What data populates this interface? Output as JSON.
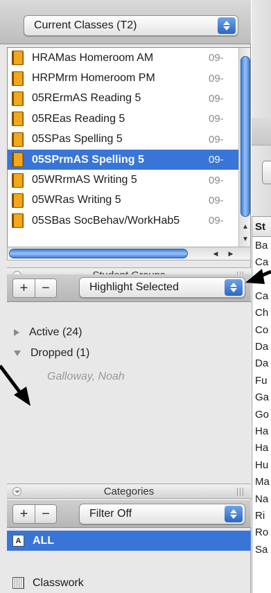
{
  "classes_popup": {
    "label": "Current Classes (T2)"
  },
  "class_list": [
    {
      "name": "HRAMas Homeroom AM",
      "date": "09-",
      "selected": false
    },
    {
      "name": "HRPMrm Homeroom PM",
      "date": "09-",
      "selected": false
    },
    {
      "name": "05RErmAS Reading 5",
      "date": "09-",
      "selected": false
    },
    {
      "name": "05REas Reading 5",
      "date": "09-",
      "selected": false
    },
    {
      "name": "05SPas Spelling 5",
      "date": "09-",
      "selected": false
    },
    {
      "name": "05SPrmAS Spelling 5",
      "date": "09-",
      "selected": true
    },
    {
      "name": "05WRrmAS Writing 5",
      "date": "09-",
      "selected": false
    },
    {
      "name": "05WRas Writing 5",
      "date": "09-",
      "selected": false
    },
    {
      "name": "05SBas SocBehav/WorkHab5",
      "date": "09-",
      "selected": false
    }
  ],
  "student_groups": {
    "title": "Student Groups",
    "add_label": "+",
    "remove_label": "−",
    "popup_label": "Highlight Selected",
    "groups": [
      {
        "label": "Active (24)",
        "expanded": false
      },
      {
        "label": "Dropped (1)",
        "expanded": true
      }
    ],
    "dropped_students": [
      "Galloway, Noah"
    ]
  },
  "categories": {
    "title": "Categories",
    "add_label": "+",
    "remove_label": "−",
    "popup_label": "Filter Off",
    "items": [
      {
        "label": "ALL",
        "icon": "A",
        "selected": true
      },
      {
        "label": "Classwork",
        "icon": "",
        "selected": false
      }
    ]
  },
  "right_table": {
    "header": "St",
    "cells": [
      "Ba",
      "Ca",
      "",
      "Ca",
      "Ch",
      "Co",
      "Da",
      "Da",
      "Fu",
      "Ga",
      "Go",
      "Ha",
      "Ha",
      "Hu",
      "Ma",
      "Na",
      "Ri",
      "Ro",
      "Sa"
    ]
  },
  "colors": {
    "selection": "#3875d7",
    "accent": "#2a66c4"
  }
}
